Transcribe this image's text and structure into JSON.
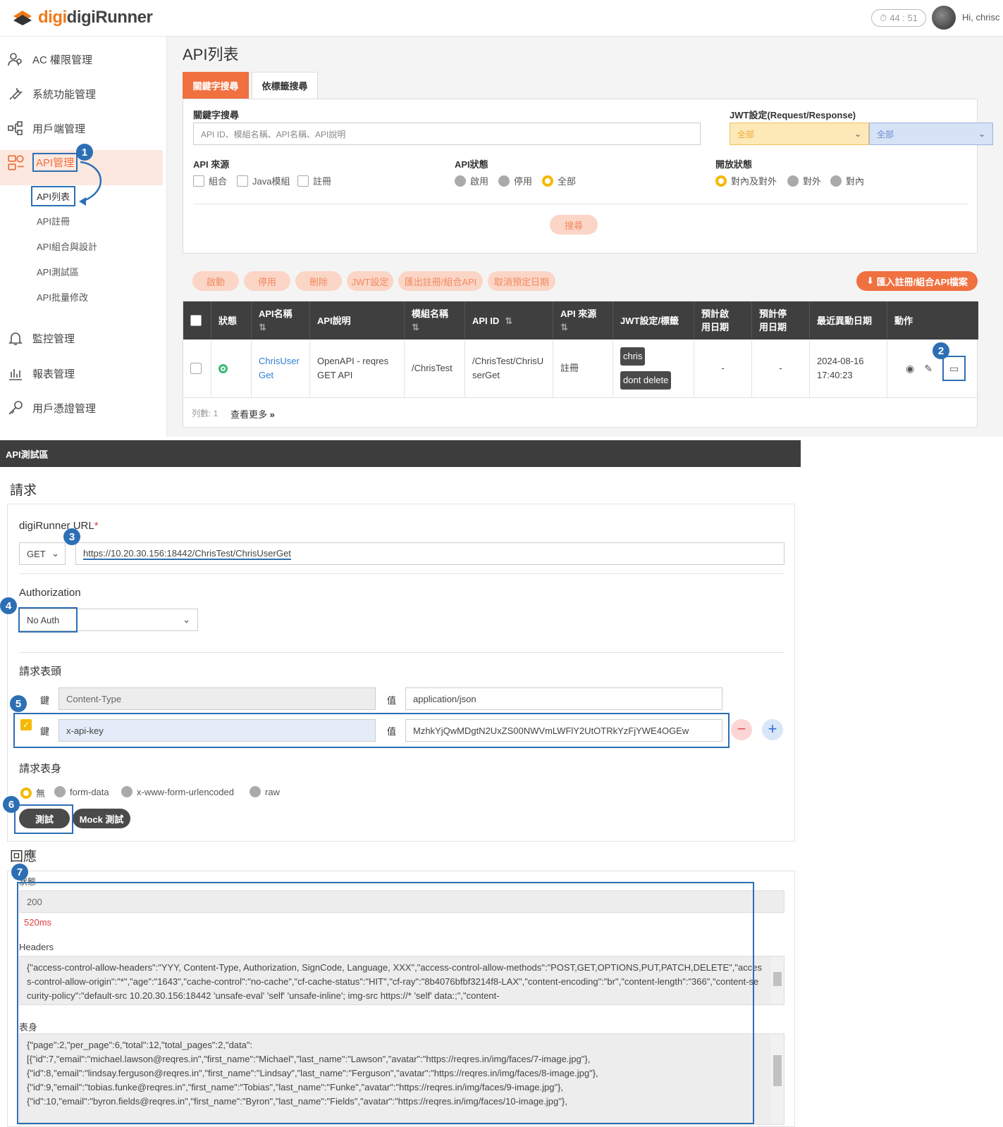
{
  "app": {
    "logo": "digiRunner",
    "timer": "44 : 51",
    "greeting": "Hi, chrisc"
  },
  "sidebar": {
    "items": [
      {
        "label": "AC 權限管理",
        "icon": "users-icon"
      },
      {
        "label": "系統功能管理",
        "icon": "wrench-icon"
      },
      {
        "label": "用戶端管理",
        "icon": "network-icon"
      },
      {
        "label": "API管理",
        "icon": "api-icon"
      },
      {
        "label": "監控管理",
        "icon": "bell-icon"
      },
      {
        "label": "報表管理",
        "icon": "bar-chart-icon"
      },
      {
        "label": "用戶憑證管理",
        "icon": "key-icon"
      }
    ],
    "subitems": [
      "API列表",
      "API註冊",
      "API組合與設計",
      "API測試區",
      "API批量修改"
    ]
  },
  "main": {
    "title": "API列表",
    "tabs": [
      "關鍵字搜尋",
      "依標籤搜尋"
    ],
    "keyword_label": "關鍵字搜尋",
    "keyword_placeholder": "API ID、模組名稱、API名稱、API說明",
    "jwt_label": "JWT設定(Request/Response)",
    "jwt_req": "全部",
    "jwt_resp": "全部",
    "source_label": "API 來源",
    "source_opts": [
      "組合",
      "Java模組",
      "註冊"
    ],
    "status_label": "API狀態",
    "status_opts": [
      "啟用",
      "停用",
      "全部"
    ],
    "open_label": "開放狀態",
    "open_opts": [
      "對內及對外",
      "對外",
      "對內"
    ],
    "search_btn": "搜尋",
    "actions": [
      "啟動",
      "停用",
      "刪除",
      "JWT設定",
      "匯出註冊/組合API",
      "取消預定日期"
    ],
    "import_btn": "匯入註冊/組合API檔案",
    "columns": [
      "狀態",
      "API名稱",
      "API說明",
      "模組名稱",
      "API ID",
      "API 來源",
      "JWT設定/標籤",
      "預計啟用日期",
      "預計停用日期",
      "最近異動日期",
      "動作"
    ],
    "row": {
      "name": "ChrisUser Get",
      "desc": "OpenAPI - reqres GET API",
      "module": "/ChrisTest",
      "api_id": "/ChrisTest/ChrisU serGet",
      "source": "註冊",
      "tags": [
        "chris",
        "dont delete"
      ],
      "enable_date": "-",
      "disable_date": "-",
      "modified": "2024-08-16 17:40:23"
    },
    "row_count": "列數: 1",
    "more": "查看更多"
  },
  "test": {
    "header": "API測試區",
    "request_title": "請求",
    "url_label": "digiRunner URL",
    "method": "GET",
    "url": "https://10.20.30.156:18442/ChrisTest/ChrisUserGet",
    "auth_label": "Authorization",
    "auth_value": "No Auth",
    "headers_label": "請求表頭",
    "key_label": "鍵",
    "value_label": "值",
    "headers": [
      {
        "key": "Content-Type",
        "value": "application/json"
      },
      {
        "key": "x-api-key",
        "value": "MzhkYjQwMDgtN2UxZS00NWVmLWFlY2UtOTRkYzFjYWE4OGEw"
      }
    ],
    "body_label": "請求表身",
    "body_opts": [
      "無",
      "form-data",
      "x-www-form-urlencoded",
      "raw"
    ],
    "test_btn": "測試",
    "mock_btn": "Mock 測試",
    "response_title": "回應",
    "status_label": "狀態",
    "status_value": "200",
    "time": "520ms",
    "resp_headers_label": "Headers",
    "resp_headers": "{\"access-control-allow-headers\":\"YYY, Content-Type, Authorization, SignCode, Language, XXX\",\"access-control-allow-methods\":\"POST,GET,OPTIONS,PUT,PATCH,DELETE\",\"access-control-allow-origin\":\"*\",\"age\":\"1643\",\"cache-control\":\"no-cache\",\"cf-cache-status\":\"HIT\",\"cf-ray\":\"8b4076bfbf3214f8-LAX\",\"content-encoding\":\"br\",\"content-length\":\"366\",\"content-security-policy\":\"default-src 10.20.30.156:18442 'unsafe-eval' 'self' 'unsafe-inline'; img-src https://* 'self' data:;\",\"content-",
    "resp_body_label": "表身",
    "resp_body": "{\"page\":2,\"per_page\":6,\"total\":12,\"total_pages\":2,\"data\":\n[{\"id\":7,\"email\":\"michael.lawson@reqres.in\",\"first_name\":\"Michael\",\"last_name\":\"Lawson\",\"avatar\":\"https://reqres.in/img/faces/7-image.jpg\"},\n{\"id\":8,\"email\":\"lindsay.ferguson@reqres.in\",\"first_name\":\"Lindsay\",\"last_name\":\"Ferguson\",\"avatar\":\"https://reqres.in/img/faces/8-image.jpg\"},\n{\"id\":9,\"email\":\"tobias.funke@reqres.in\",\"first_name\":\"Tobias\",\"last_name\":\"Funke\",\"avatar\":\"https://reqres.in/img/faces/9-image.jpg\"},\n{\"id\":10,\"email\":\"byron.fields@reqres.in\",\"first_name\":\"Byron\",\"last_name\":\"Fields\",\"avatar\":\"https://reqres.in/img/faces/10-image.jpg\"},"
  },
  "badges": [
    "1",
    "2",
    "3",
    "4",
    "5",
    "6",
    "7"
  ],
  "colors": {
    "accent": "#f07040",
    "annotation": "#2d6fb4",
    "header_dark": "#3f3f3f"
  }
}
